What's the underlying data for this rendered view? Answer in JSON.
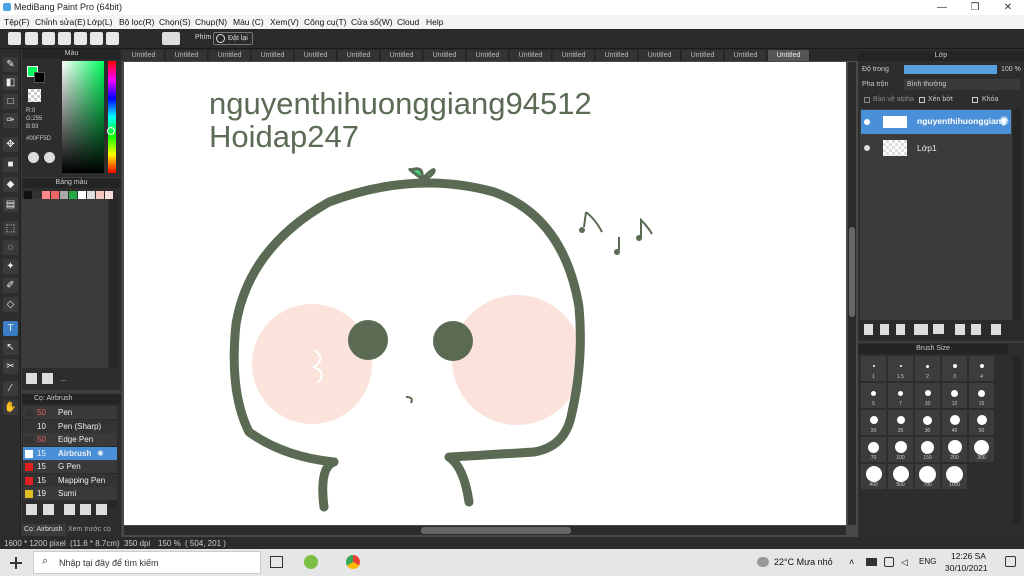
{
  "app": {
    "title": "MediBang Paint Pro (64bit)"
  },
  "menu": [
    "Tệp(F)",
    "Chỉnh sửa(E)",
    "Lớp(L)",
    "Bộ lọc(R)",
    "Chọn(S)",
    "Chụp(N)",
    "Màu (C)",
    "Xem(V)",
    "Công cụ(T)",
    "Cửa sổ(W)",
    "Cloud",
    "Help"
  ],
  "toolbar": {
    "key_label": "Phím",
    "reset_label": "Đặt lại"
  },
  "color_panel": {
    "title": "Màu",
    "r": "R:0",
    "g": "G:255",
    "b": "B:93",
    "hex": "#00FF5D",
    "foreground": "#00ff5d",
    "background": "#000000"
  },
  "palette": {
    "title": "Bảng màu",
    "dots": "...",
    "colors": [
      "#111111",
      "#333333",
      "#ff8888",
      "#ee6666",
      "#aaaaaa",
      "#22aa44",
      "#ffffff",
      "#dddddd",
      "#f3c7c0",
      "#f7e0dc"
    ]
  },
  "brush_panel": {
    "title": "Cọ: Airbrush",
    "tab1": "Cọ: Airbrush",
    "tab2": "Xem trước cọ",
    "items": [
      {
        "size": "50",
        "name": "Pen",
        "color": "#333333"
      },
      {
        "size": "10",
        "name": "Pen (Sharp)",
        "color": "#333333"
      },
      {
        "size": "50",
        "name": "Edge Pen",
        "color": "#333333"
      },
      {
        "size": "15",
        "name": "Airbrush",
        "color": "#ffffff"
      },
      {
        "size": "15",
        "name": "G Pen",
        "color": "#e02020"
      },
      {
        "size": "15",
        "name": "Mapping Pen",
        "color": "#e02020"
      },
      {
        "size": "19",
        "name": "Sumi",
        "color": "#e0c020"
      }
    ]
  },
  "tabs": [
    "Untitled",
    "Untitled",
    "Untitled",
    "Untitled",
    "Untitled",
    "Untitled",
    "Untitled",
    "Untitled",
    "Untitled",
    "Untitled",
    "Untitled",
    "Untitled",
    "Untitled",
    "Untitled",
    "Untitled",
    "Untitled"
  ],
  "canvas": {
    "line1": "nguyenthihuonggiang94512",
    "line2": "Hoidap247"
  },
  "layers_panel": {
    "title": "Lớp",
    "opacity_label": "Độ trong",
    "opacity_value": "100 %",
    "opacity": 1.0,
    "blend_label": "Pha trộn",
    "blend_value": "Bình thường",
    "protect_alpha": "Bảo vệ alpha",
    "clipping": "Xén bớt",
    "lock": "Khóa",
    "layers": [
      {
        "name": "nguyenthihuonggiang",
        "selected": true
      },
      {
        "name": "Lớp1",
        "selected": false
      }
    ]
  },
  "brush_size": {
    "title": "Brush Size",
    "sizes": [
      "1",
      "1.5",
      "2",
      "3",
      "4",
      "5",
      "7",
      "10",
      "12",
      "15",
      "20",
      "25",
      "30",
      "40",
      "50",
      "70",
      "100",
      "150",
      "200",
      "300",
      "400",
      "500",
      "700",
      "1000"
    ]
  },
  "status": {
    "dimensions": "1600 * 1200 pixel",
    "physical": "(11.6 * 8.7cm)",
    "dpi": "350 dpi",
    "zoom": "150 %",
    "coords": "( 504, 201 )"
  },
  "taskbar": {
    "search": "Nhập tại đây để tìm kiếm",
    "weather": "22°C  Mưa nhỏ",
    "lang": "ENG",
    "time": "12:26 SA",
    "date": "30/10/2021"
  }
}
